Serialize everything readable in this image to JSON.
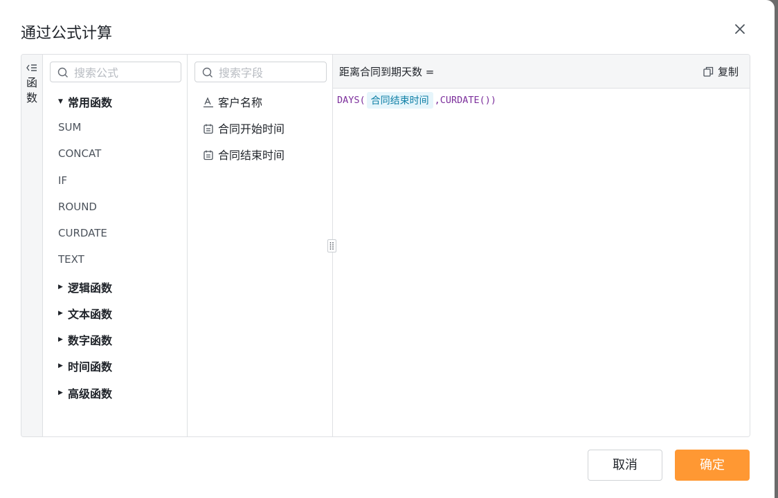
{
  "dialog": {
    "title": "通过公式计算",
    "cancel_label": "取消",
    "confirm_label": "确定"
  },
  "rail": {
    "label": "函数"
  },
  "functions": {
    "search_placeholder": "搜索公式",
    "expanded_category": "常用函数",
    "common": [
      "SUM",
      "CONCAT",
      "IF",
      "ROUND",
      "CURDATE",
      "TEXT"
    ],
    "collapsed_categories": [
      "逻辑函数",
      "文本函数",
      "数字函数",
      "时间函数",
      "高级函数"
    ]
  },
  "fields": {
    "search_placeholder": "搜索字段",
    "items": [
      {
        "label": "客户名称",
        "icon": "text-field-icon"
      },
      {
        "label": "合同开始时间",
        "icon": "calendar-icon"
      },
      {
        "label": "合同结束时间",
        "icon": "calendar-icon"
      }
    ]
  },
  "editor": {
    "title": "距离合同到期天数 =",
    "copy_label": "复制",
    "formula": {
      "prefix": "DAYS(",
      "field_chip": "合同结束时间",
      "suffix": ",CURDATE())"
    }
  },
  "colors": {
    "accent": "#ff9833",
    "chip_bg": "#e6f5fb",
    "chip_text": "#0e7fa6",
    "function_text": "#7c2f9c"
  }
}
